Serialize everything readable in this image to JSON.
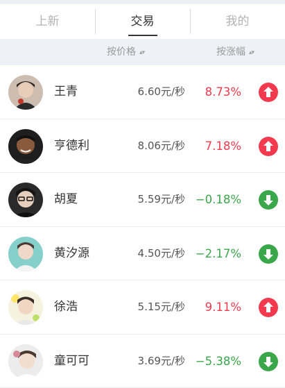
{
  "tabs": [
    "上新",
    "交易",
    "我的"
  ],
  "active_tab": 1,
  "sort": {
    "price_label": "按价格",
    "change_label": "按涨幅"
  },
  "colors": {
    "up": "#f23a4e",
    "down": "#3aa74a",
    "tab_active": "#333333",
    "tab_inactive": "#b3b3b3"
  },
  "rows": [
    {
      "name": "王青",
      "price": "6.60元/秒",
      "change": "8.73%",
      "trend": "up",
      "arrow_icon": "arrow-up-icon"
    },
    {
      "name": "亨德利",
      "price": "8.06元/秒",
      "change": "7.18%",
      "trend": "up",
      "arrow_icon": "arrow-up-icon"
    },
    {
      "name": "胡夏",
      "price": "5.59元/秒",
      "change": "−0.18%",
      "trend": "down",
      "arrow_icon": "arrow-down-icon"
    },
    {
      "name": "黄汐源",
      "price": "4.50元/秒",
      "change": "−2.17%",
      "trend": "down",
      "arrow_icon": "arrow-down-icon"
    },
    {
      "name": "徐浩",
      "price": "5.15元/秒",
      "change": "9.11%",
      "trend": "up",
      "arrow_icon": "arrow-up-icon"
    },
    {
      "name": "童可可",
      "price": "3.69元/秒",
      "change": "−5.38%",
      "trend": "down",
      "arrow_icon": "arrow-down-icon"
    }
  ]
}
